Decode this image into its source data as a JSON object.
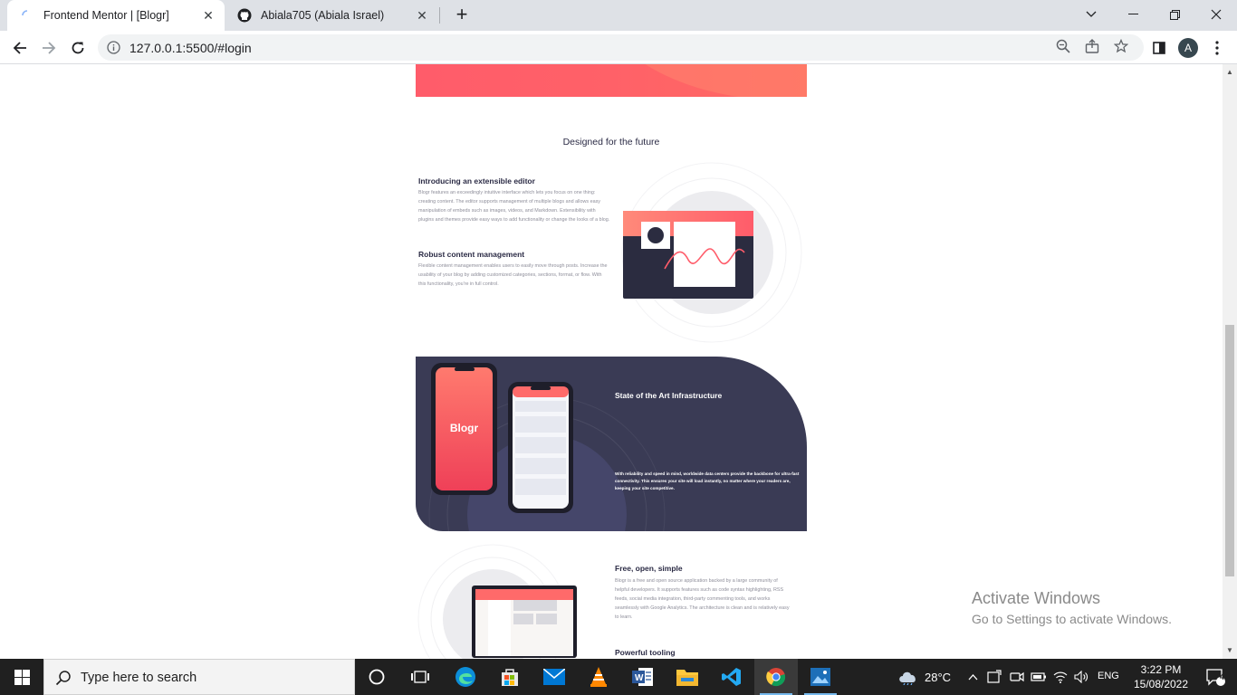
{
  "browser": {
    "tabs": [
      {
        "title": "Frontend Mentor | [Blogr]",
        "active": true
      },
      {
        "title": "Abiala705 (Abiala Israel)",
        "active": false
      }
    ],
    "url": "127.0.0.1:5500/#login",
    "profile_initial": "A"
  },
  "page": {
    "section_title": "Designed for the future",
    "features": [
      {
        "heading": "Introducing an extensible editor",
        "body": "Blogr features an exceedingly intuitive interface which lets you focus on one thing: creating content. The editor supports management of multiple blogs and allows easy manipulation of embeds such as images, videos, and Markdown. Extensibility with plugins and themes provide easy ways to add functionality or change the looks of a blog."
      },
      {
        "heading": "Robust content management",
        "body": "Flexible content management enables users to easily move through posts. Increase the usability of your blog by adding customized categories, sections, format, or flow. With this functionality, you're in full control."
      }
    ],
    "infrastructure": {
      "phone_label": "Blogr",
      "heading": "State of the Art Infrastructure",
      "body": "With reliability and speed in mind, worldwide data centers provide the backbone for ultra-fast connectivity. This ensures your site will load instantly, no matter where your readers are, keeping your site competitive."
    },
    "features2": [
      {
        "heading": "Free, open, simple",
        "body": "Blogr is a free and open source application backed by a large community of helpful developers. It supports features such as code syntax highlighting, RSS feeds, social media integration, third-party commenting tools, and works seamlessly with Google Analytics. The architecture is clean and is relatively easy to learn."
      },
      {
        "heading": "Powerful tooling",
        "body": ""
      }
    ],
    "watermark": {
      "line1": "Activate Windows",
      "line2": "Go to Settings to activate Windows."
    }
  },
  "taskbar": {
    "search_placeholder": "Type here to search",
    "temperature": "28°C",
    "language": "ENG",
    "time": "3:22 PM",
    "date": "15/08/2022",
    "notifications": "4"
  },
  "colors": {
    "accent_coral": "#ff5c6a",
    "dark_navy": "#2b2b45",
    "panel_navy": "#3a3b55"
  }
}
